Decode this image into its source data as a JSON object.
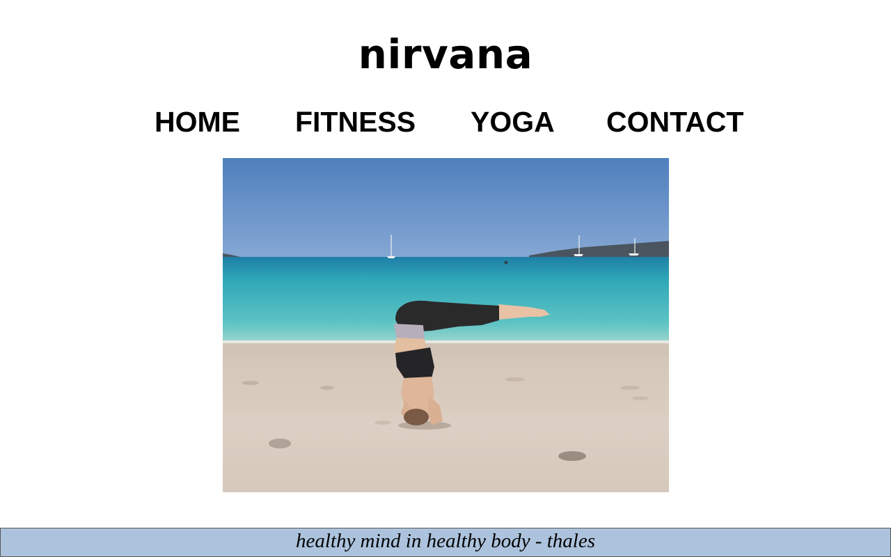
{
  "site": {
    "title": "nirvana"
  },
  "nav": {
    "items": [
      {
        "label": "HOME"
      },
      {
        "label": "FITNESS"
      },
      {
        "label": "YOGA"
      },
      {
        "label": "CONTACT"
      }
    ]
  },
  "hero": {
    "alt": "Woman doing a headstand yoga pose on a sandy beach by the sea"
  },
  "footer": {
    "quote": "healthy mind in healthy body - thales"
  },
  "colors": {
    "background": "#ffffff",
    "text": "#000000",
    "footer_bg": "#adc3dd",
    "sky": "#5e8cc4",
    "sea": "#3bb3bf",
    "sand": "#d8ccc0"
  }
}
